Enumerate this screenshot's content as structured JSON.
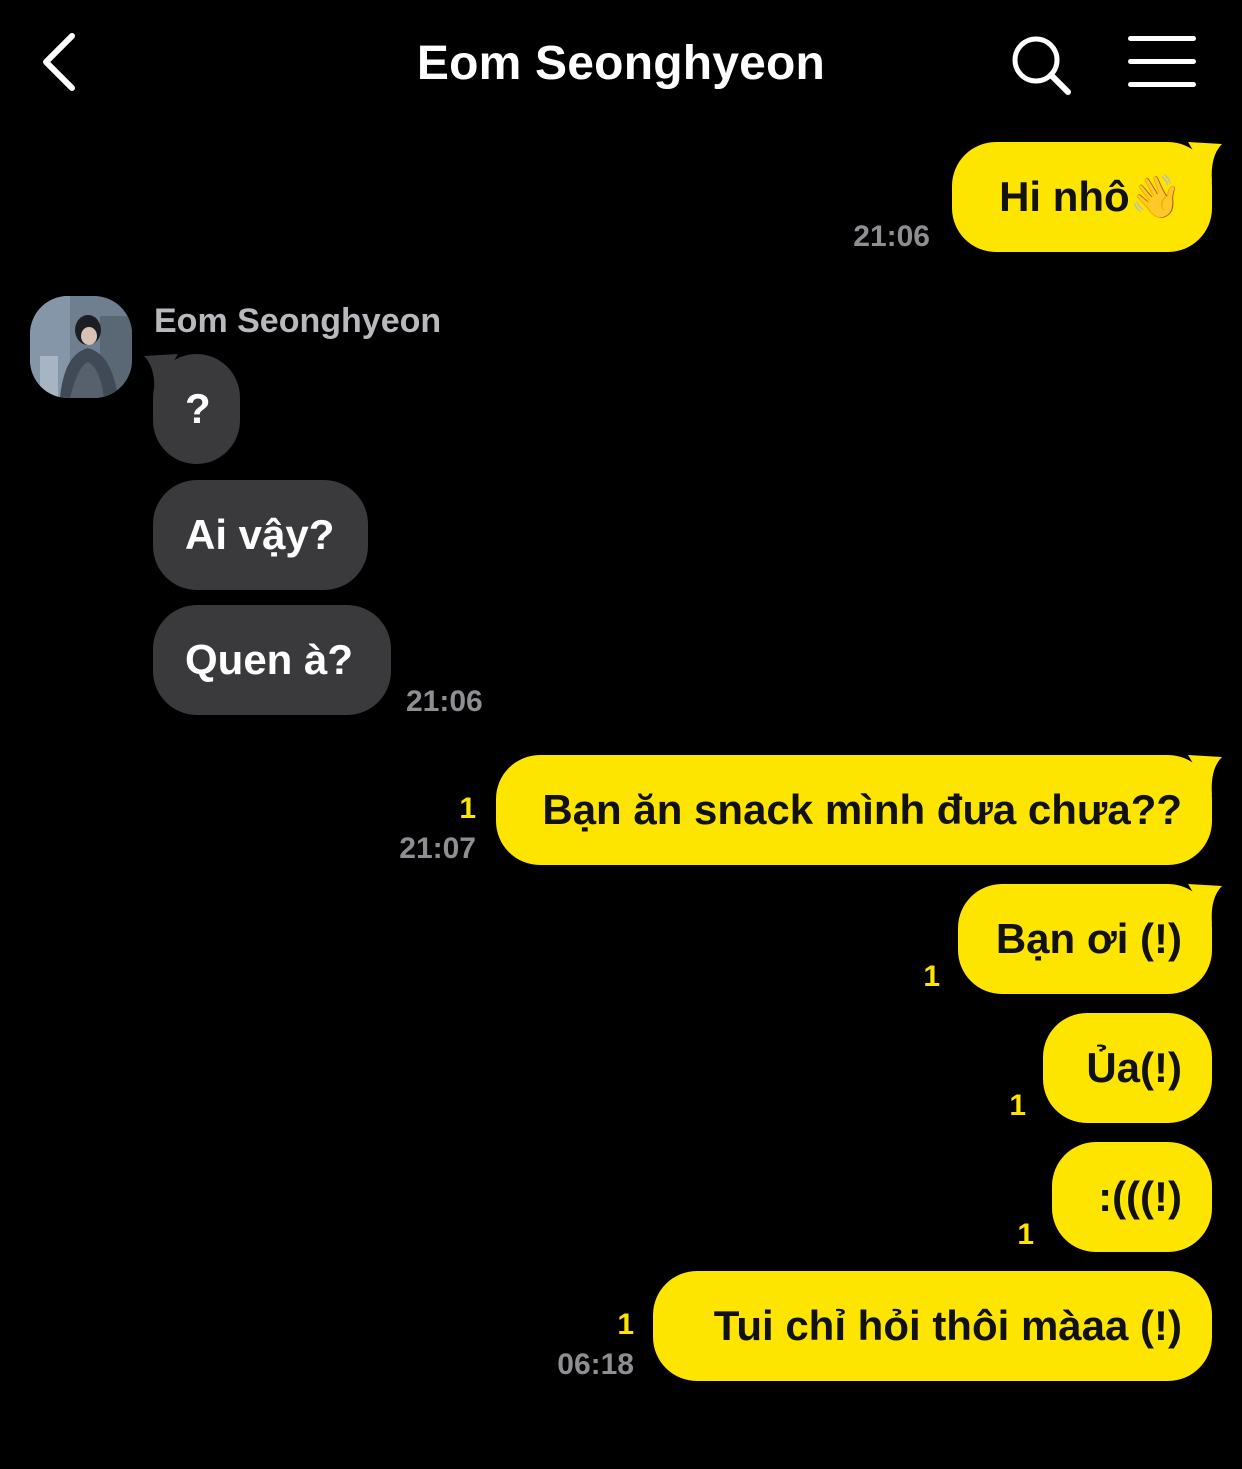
{
  "header": {
    "title": "Eom Seonghyeon"
  },
  "contact": {
    "name": "Eom Seonghyeon"
  },
  "messages": {
    "m1": {
      "text": "Hi nhô👋",
      "time": "21:06"
    },
    "t1": {
      "text": "?"
    },
    "t2": {
      "text": "Ai vậy?"
    },
    "t3": {
      "text": "Quen à?",
      "time": "21:06"
    },
    "m2": {
      "text": "Bạn ăn snack mình đưa chưa??",
      "unread": "1",
      "time": "21:07"
    },
    "m3": {
      "text": "Bạn ơi (!)",
      "unread": "1"
    },
    "m4": {
      "text": "Ủa(!)",
      "unread": "1"
    },
    "m5": {
      "text": ":(((!)",
      "unread": "1"
    },
    "m6": {
      "text": "Tui chỉ hỏi thôi màaa (!)",
      "unread": "1",
      "time": "06:18"
    }
  },
  "colors": {
    "my_bubble": "#FEE500",
    "their_bubble": "#3a3a3c",
    "background": "#000000"
  }
}
